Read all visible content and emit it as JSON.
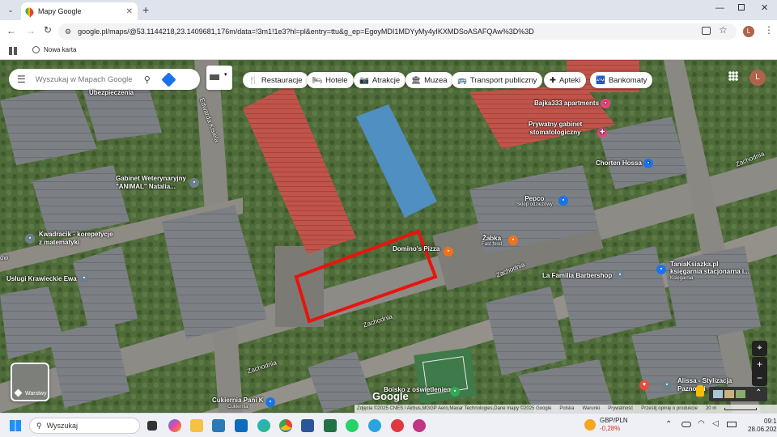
{
  "browser": {
    "tab_title": "Mapy Google",
    "url": "google.pl/maps/@53.1144218,23.1409681,176m/data=!3m1!1e3?hl=pl&entry=ttu&g_ep=EgoyMDI1MDYyMy4yIKXMDSoASAFQAw%3D%3D",
    "bookmark_new_tab": "Nowa karta",
    "profile_initial": "L"
  },
  "search": {
    "placeholder": "Wyszukaj w Mapach Google"
  },
  "categories": [
    {
      "label": "Restauracje",
      "icon": "fork-knife-icon"
    },
    {
      "label": "Hotele",
      "icon": "bed-icon"
    },
    {
      "label": "Atrakcje",
      "icon": "camera-icon"
    },
    {
      "label": "Muzea",
      "icon": "museum-icon"
    },
    {
      "label": "Transport publiczny",
      "icon": "bus-icon"
    },
    {
      "label": "Apteki",
      "icon": "pharmacy-icon"
    },
    {
      "label": "Bankomaty",
      "icon": "atm-icon"
    }
  ],
  "places": {
    "obezpieczenia": "Ubezpieczenia",
    "bajka": "Bajka333 apartments",
    "gabinet_stom": "Prywatny gabinet stomatologiczny",
    "chorten": "Chorten Hossa",
    "gabinet_wet_1": "Gabinet Weterynaryjny",
    "gabinet_wet_2": "\"ANIMAL\" Natalia...",
    "pepco": "Pepco",
    "pepco_sub": "Sklep odzieżowy",
    "zabka": "Żabka",
    "zabka_sub": "Fast food",
    "dominos": "Domino's Pizza",
    "kwadracik_1": "Kwadracik - korepetycje",
    "kwadracik_2": "z matematyki",
    "uslugi": "Usługi Krawieckie Ewa",
    "lafamilia": "La Familia Barbershop",
    "tania_1": "TaniaKsiazka.pl",
    "tania_2": "księgarnia stacjonarna i...",
    "tania_sub": "Księgarnia",
    "boisko": "Boisko z oświetleniem",
    "alissa_1": "Alissa - Stylizacja",
    "alissa_2": "Paznokci",
    "cukiernia": "Cukiernia Pani K",
    "cukiernia_sub": "Cukiernia",
    "zachodnia": "Zachodnia",
    "edwarda": "Edwarda Kisiela",
    "bow": "ów"
  },
  "map_controls": {
    "layers_label": "Warstwy",
    "google_logo": "Google"
  },
  "footer": {
    "attribution": "Zdjęcia ©2025 CNES / Airbus,MGGP Aero,Maxar Technologies,Dane mapy ©2025 Google",
    "polska": "Polska",
    "warunki": "Warunki",
    "prywatnosc": "Prywatność",
    "opinie": "Prześlij opinię o produkcie",
    "scale": "20 m"
  },
  "taskbar": {
    "search_placeholder": "Wyszukaj",
    "currency": "GBP/PLN",
    "currency_change": "-0,28%",
    "time": "09:10",
    "date": "28.06.2025"
  },
  "colors": {
    "highlight": "#e8140f",
    "accent": "#1a73e8",
    "negative": "#d93025"
  }
}
